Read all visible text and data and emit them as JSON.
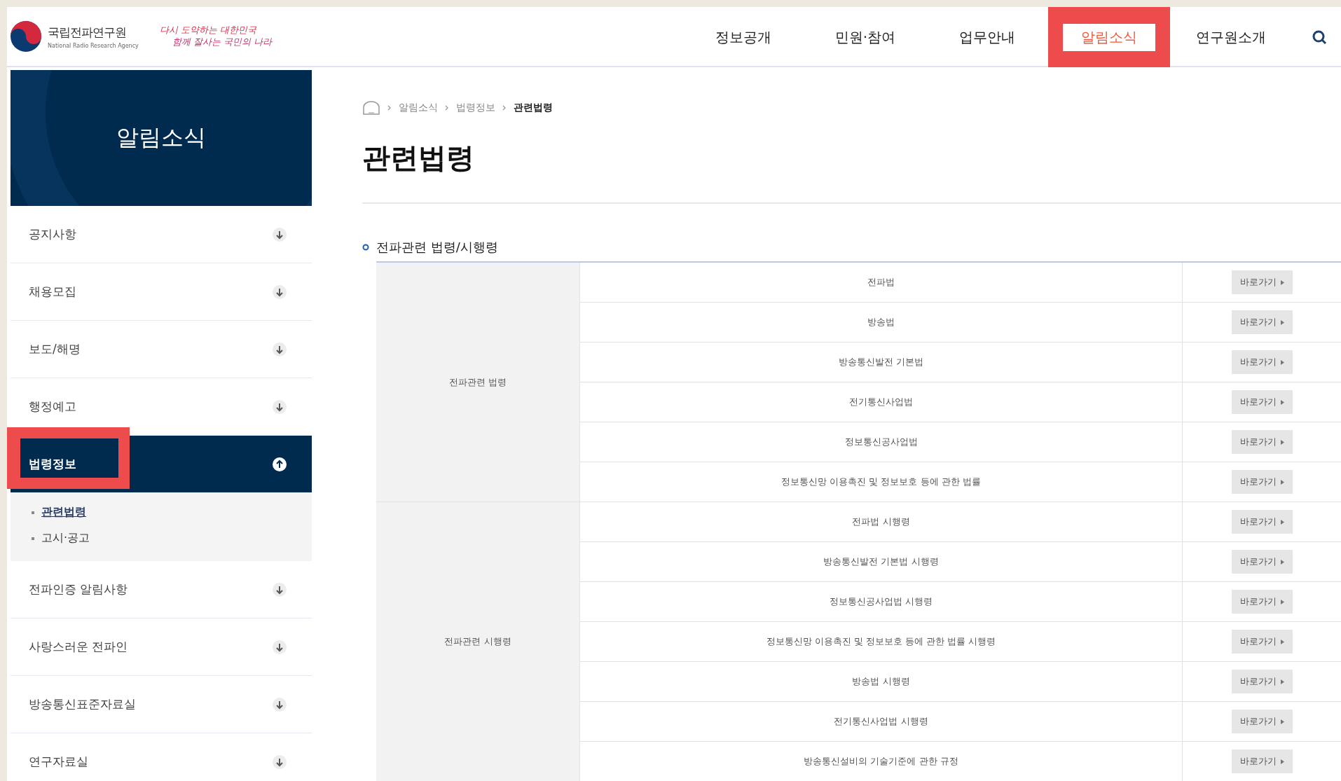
{
  "header": {
    "logo_name": "국립전파연구원",
    "logo_subtitle": "National Radio Research Agency",
    "slogan_lines": [
      "다시 도약하는 대한민국",
      "함께 잘사는 국민의 나라"
    ],
    "nav": [
      {
        "label": "정보공개",
        "selected": false,
        "highlighted": false
      },
      {
        "label": "민원·참여",
        "selected": false,
        "highlighted": false
      },
      {
        "label": "업무안내",
        "selected": false,
        "highlighted": false
      },
      {
        "label": "알림소식",
        "selected": true,
        "highlighted": true
      },
      {
        "label": "연구원소개",
        "selected": false,
        "highlighted": false
      }
    ]
  },
  "sidebar": {
    "title": "알림소식",
    "items": [
      {
        "label": "공지사항",
        "expanded": false,
        "highlighted": false
      },
      {
        "label": "채용모집",
        "expanded": false,
        "highlighted": false
      },
      {
        "label": "보도/해명",
        "expanded": false,
        "highlighted": false
      },
      {
        "label": "행정예고",
        "expanded": false,
        "highlighted": false
      },
      {
        "label": "법령정보",
        "expanded": true,
        "highlighted": true,
        "children": [
          {
            "label": "관련법령",
            "selected": true
          },
          {
            "label": "고시·공고",
            "selected": false
          }
        ]
      },
      {
        "label": "전파인증 알림사항",
        "expanded": false,
        "highlighted": false
      },
      {
        "label": "사랑스러운 전파인",
        "expanded": false,
        "highlighted": false
      },
      {
        "label": "방송통신표준자료실",
        "expanded": false,
        "highlighted": false
      },
      {
        "label": "연구자료실",
        "expanded": false,
        "highlighted": false
      }
    ]
  },
  "breadcrumb": [
    "알림소식",
    "법령정보",
    "관련법령"
  ],
  "page_title": "관련법령",
  "section_title": "전파관련 법령/시행령",
  "table": {
    "groups": [
      {
        "name": "전파관련 법령",
        "rows": [
          {
            "law": "전파법",
            "button": "바로가기"
          },
          {
            "law": "방송법",
            "button": "바로가기"
          },
          {
            "law": "방송통신발전 기본법",
            "button": "바로가기"
          },
          {
            "law": "전기통신사업법",
            "button": "바로가기"
          },
          {
            "law": "정보통신공사업법",
            "button": "바로가기"
          },
          {
            "law": "정보통신망 이용촉진 및 정보보호 등에 관한 법률",
            "button": "바로가기"
          }
        ]
      },
      {
        "name": "전파관련 시행령",
        "rows": [
          {
            "law": "전파법 시행령",
            "button": "바로가기"
          },
          {
            "law": "방송통신발전 기본법 시행령",
            "button": "바로가기"
          },
          {
            "law": "정보통신공사업법 시행령",
            "button": "바로가기"
          },
          {
            "law": "정보통신망 이용촉진 및 정보보호 등에 관한 법률 시행령",
            "button": "바로가기"
          },
          {
            "law": "방송법 시행령",
            "button": "바로가기"
          },
          {
            "law": "전기통신사업법 시행령",
            "button": "바로가기"
          },
          {
            "law": "방송통신설비의 기술기준에 관한 규정",
            "button": "바로가기"
          }
        ]
      }
    ]
  }
}
